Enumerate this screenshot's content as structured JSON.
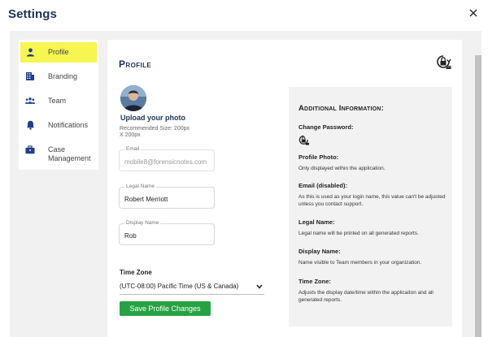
{
  "dialog": {
    "title": "Settings",
    "close_icon": "close-icon"
  },
  "sidebar": {
    "items": [
      {
        "label": "Profile",
        "icon": "person-icon",
        "active": true
      },
      {
        "label": "Branding",
        "icon": "building-icon",
        "active": false
      },
      {
        "label": "Team",
        "icon": "team-icon",
        "active": false
      },
      {
        "label": "Notifications",
        "icon": "bell-icon",
        "active": false
      },
      {
        "label": "Case Management",
        "icon": "briefcase-icon",
        "active": false
      }
    ]
  },
  "profile": {
    "title": "Profile",
    "lock_icon": "lock-reset-icon",
    "upload_label": "Upload your photo",
    "recommended_size": "Recommended Size: 200px X 200px",
    "email": {
      "label": "Email",
      "value": "mobile8@forensicnotes.com",
      "disabled": true
    },
    "legal_name": {
      "label": "Legal Name",
      "value": "Robert Merriott"
    },
    "display_name": {
      "label": "Display Name",
      "value": "Rob"
    },
    "time_zone": {
      "label": "Time Zone",
      "value": "(UTC-08:00) Pacific Time (US & Canada)"
    },
    "save_label": "Save Profile Changes"
  },
  "info": {
    "title": "Additional Information:",
    "change_password": "Change Password:",
    "profile_photo_head": "Profile Photo:",
    "profile_photo_text": "Only displayed within the application.",
    "email_head": "Email (disabled):",
    "email_text": "As this is used as your login name, this value can't be adjusted unless you contact support.",
    "legal_head": "Legal Name:",
    "legal_text": "Legal name will be printed on all generated reports.",
    "display_head": "Display Name:",
    "display_text": "Name visible to Team members in your organization.",
    "tz_head": "Time Zone:",
    "tz_text": "Adjusts the display date/time within the applicaiton and all generated reports."
  },
  "colors": {
    "accent_yellow": "#f7f550",
    "icon_blue": "#1f3f8a",
    "save_green": "#27a243",
    "title_navy": "#1f3350"
  }
}
